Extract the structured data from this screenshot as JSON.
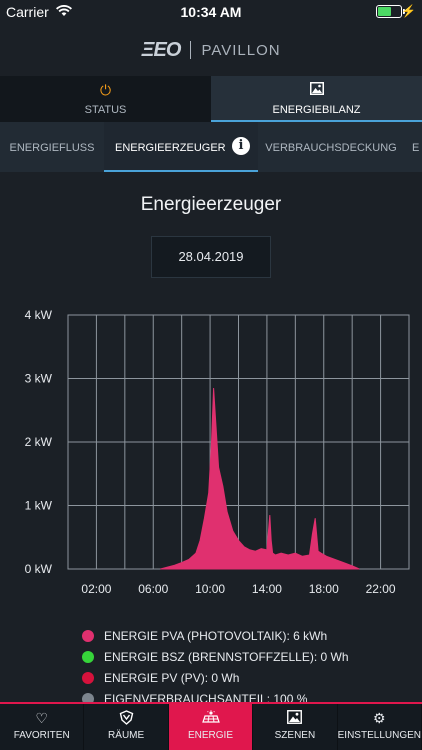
{
  "status_bar": {
    "carrier": "Carrier",
    "time": "10:34 AM",
    "battery_level": 0.6
  },
  "header": {
    "logo": "ΞEO",
    "name": "PAVILLON"
  },
  "main_tabs": [
    {
      "label": "STATUS",
      "icon": "power-icon",
      "active": false
    },
    {
      "label": "ENERGIEBILANZ",
      "icon": "image-icon",
      "active": true
    }
  ],
  "sub_tabs": [
    {
      "label": "ENERGIEFLUSS"
    },
    {
      "label": "ENERGIEERZEUGER"
    },
    {
      "label": "VERBRAUCHSDECKUNG"
    },
    {
      "label": "E"
    }
  ],
  "page": {
    "title": "Energieerzeuger",
    "date": "28.04.2019"
  },
  "chart_data": {
    "type": "area",
    "title": "",
    "xlabel": "",
    "ylabel": "",
    "x_ticks": [
      "02:00",
      "06:00",
      "10:00",
      "14:00",
      "18:00",
      "22:00"
    ],
    "y_ticks": [
      "0 kW",
      "1 kW",
      "2 kW",
      "3 kW",
      "4 kW"
    ],
    "xlim": [
      0,
      24
    ],
    "ylim": [
      0,
      4
    ],
    "grid": true,
    "series": [
      {
        "name": "ENERGIE PVA (PHOTOVOLTAIK): 6 kWh",
        "color": "#e0306f",
        "x": [
          6.5,
          7.0,
          7.5,
          8.0,
          8.5,
          9.0,
          9.3,
          9.6,
          9.9,
          10.1,
          10.25,
          10.4,
          10.6,
          10.9,
          11.2,
          11.6,
          12.0,
          12.4,
          12.8,
          13.2,
          13.6,
          14.0,
          14.2,
          14.3,
          14.4,
          14.6,
          15.0,
          15.5,
          16.0,
          16.5,
          17.0,
          17.2,
          17.4,
          17.5,
          17.6,
          17.8,
          18.2,
          18.8,
          19.4,
          20.0,
          20.5
        ],
        "values": [
          0.0,
          0.03,
          0.06,
          0.1,
          0.15,
          0.25,
          0.45,
          0.8,
          1.2,
          2.0,
          2.85,
          2.3,
          1.6,
          1.3,
          0.9,
          0.6,
          0.45,
          0.35,
          0.3,
          0.28,
          0.32,
          0.3,
          0.85,
          0.45,
          0.25,
          0.22,
          0.25,
          0.22,
          0.25,
          0.2,
          0.22,
          0.55,
          0.8,
          0.55,
          0.28,
          0.25,
          0.2,
          0.15,
          0.1,
          0.05,
          0.0
        ]
      },
      {
        "name": "ENERGIE BSZ (BRENNSTOFFZELLE): 0 Wh",
        "color": "#36d43a",
        "values": []
      },
      {
        "name": "ENERGIE PV (PV): 0 Wh",
        "color": "#d6123c",
        "values": []
      },
      {
        "name": "EIGENVERBRAUCHSANTEIL: 100 %",
        "color": "#7d858e",
        "values": []
      }
    ]
  },
  "bottom_nav": [
    {
      "label": "FAVORITEN",
      "icon": "heart-icon",
      "active": false
    },
    {
      "label": "RÄUME",
      "icon": "shield-icon",
      "active": false
    },
    {
      "label": "ENERGIE",
      "icon": "solar-panel-icon",
      "active": true
    },
    {
      "label": "SZENEN",
      "icon": "image-icon",
      "active": false
    },
    {
      "label": "EINSTELLUNGEN",
      "icon": "gear-icon",
      "active": false
    }
  ]
}
